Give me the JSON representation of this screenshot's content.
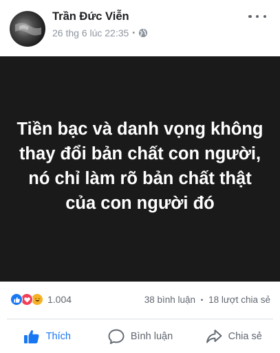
{
  "post": {
    "author": "Trần Đức Viễn",
    "timestamp": "26 thg 6 lúc 22:35",
    "separator": "•",
    "privacy_icon": "globe-icon",
    "image_text": "Tiền bạc và danh vọng không thay đổi bản chất con người, nó chỉ làm rõ bản chất thật của con người đó"
  },
  "stats": {
    "reaction_icons": [
      "like-icon",
      "love-icon",
      "haha-icon"
    ],
    "reaction_count": "1.004",
    "comments": "38 bình luận",
    "separator": "•",
    "shares": "18 lượt chia sẻ"
  },
  "actions": {
    "like_label": "Thích",
    "comment_label": "Bình luận",
    "share_label": "Chia sẻ"
  },
  "colors": {
    "accent": "#1877f2",
    "like": "#1877f2",
    "love": "#f33e58",
    "haha": "#f7b125",
    "image_background": "#1a1a1a",
    "secondary_text": "#606770"
  }
}
